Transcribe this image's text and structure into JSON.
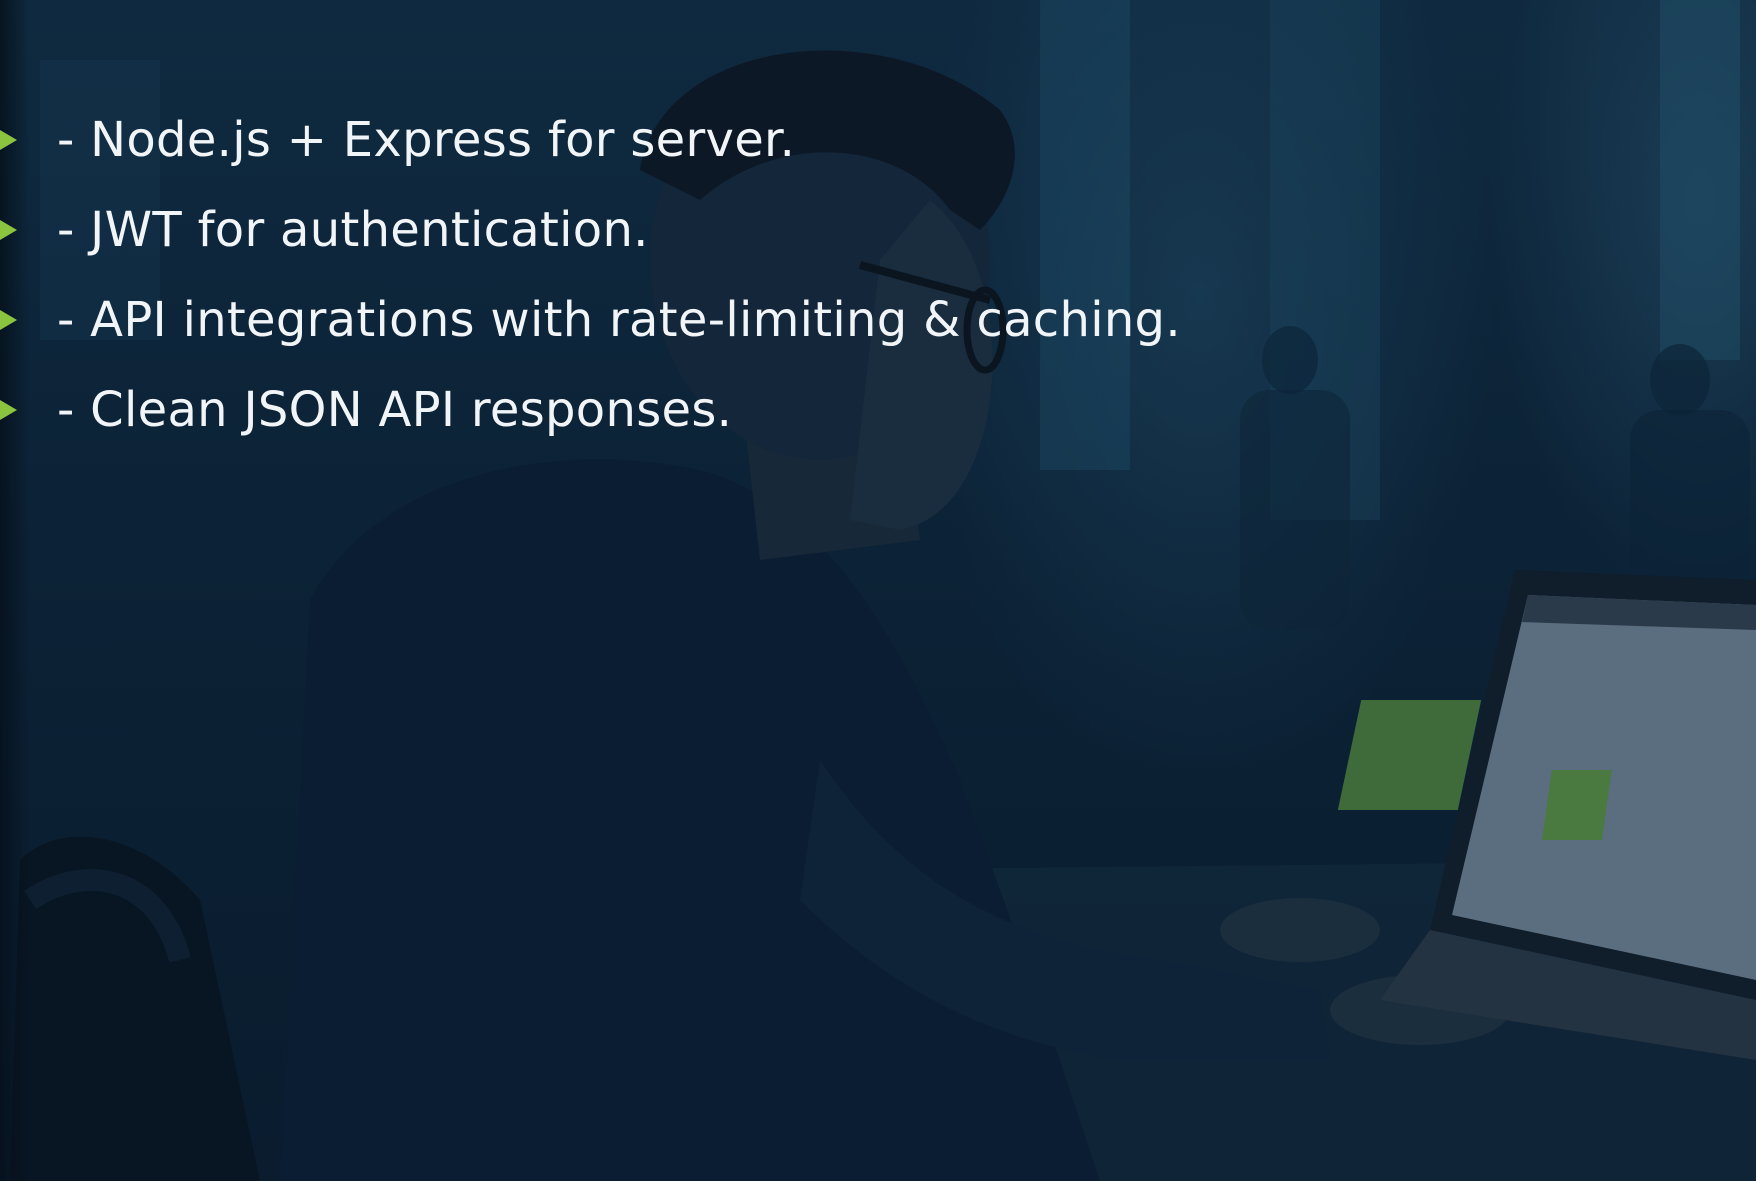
{
  "slide": {
    "bullets": [
      "- Node.js + Express for server.",
      "- JWT for authentication.",
      "- API integrations with rate-limiting & caching.",
      "- Clean JSON API responses."
    ],
    "background_image": "developer-at-laptop-photo",
    "accent_color": "#8bc53f",
    "text_color": "#f2f5f7"
  }
}
